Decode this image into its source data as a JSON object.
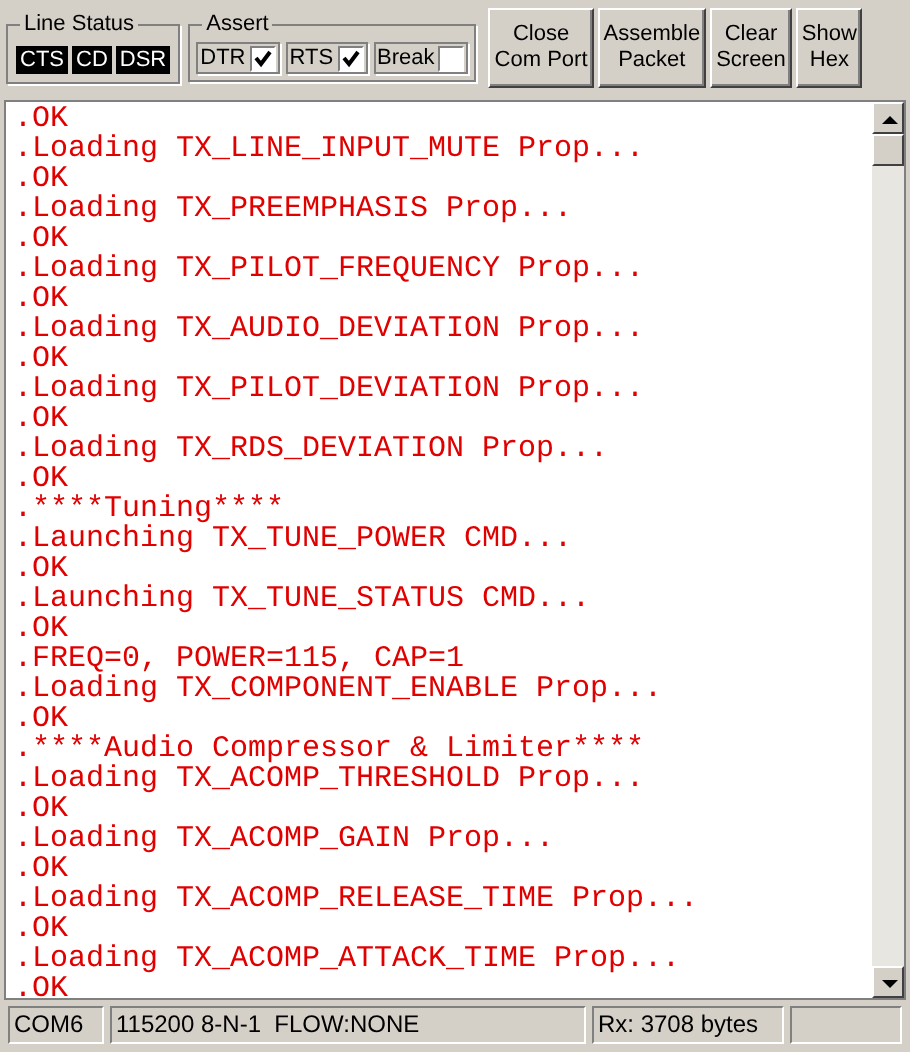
{
  "line_status": {
    "title": "Line Status",
    "signals": [
      {
        "label": "CTS",
        "on": true
      },
      {
        "label": "CD",
        "on": true
      },
      {
        "label": "DSR",
        "on": true
      }
    ]
  },
  "assert": {
    "title": "Assert",
    "items": [
      {
        "label": "DTR",
        "checked": true
      },
      {
        "label": "RTS",
        "checked": true
      },
      {
        "label": "Break",
        "checked": false
      }
    ]
  },
  "buttons": [
    {
      "label": "Close\nCom Port"
    },
    {
      "label": "Assemble\nPacket"
    },
    {
      "label": "Clear\nScreen"
    },
    {
      "label": "Show\nHex"
    }
  ],
  "terminal_lines": [
    ".OK",
    ".Loading TX_LINE_INPUT_MUTE Prop...",
    ".OK",
    ".Loading TX_PREEMPHASIS Prop...",
    ".OK",
    ".Loading TX_PILOT_FREQUENCY Prop...",
    ".OK",
    ".Loading TX_AUDIO_DEVIATION Prop...",
    ".OK",
    ".Loading TX_PILOT_DEVIATION Prop...",
    ".OK",
    ".Loading TX_RDS_DEVIATION Prop...",
    ".OK",
    ".****Tuning****",
    ".Launching TX_TUNE_POWER CMD...",
    ".OK",
    ".Launching TX_TUNE_STATUS CMD...",
    ".OK",
    ".FREQ=0, POWER=115, CAP=1",
    ".Loading TX_COMPONENT_ENABLE Prop...",
    ".OK",
    ".****Audio Compressor & Limiter****",
    ".Loading TX_ACOMP_THRESHOLD Prop...",
    ".OK",
    ".Loading TX_ACOMP_GAIN Prop...",
    ".OK",
    ".Loading TX_ACOMP_RELEASE_TIME Prop...",
    ".OK",
    ".Loading TX_ACOMP_ATTACK_TIME Prop...",
    ".OK"
  ],
  "status_bar": [
    "COM6",
    "115200 8-N-1  FLOW:NONE",
    "Rx: 3708 bytes"
  ]
}
